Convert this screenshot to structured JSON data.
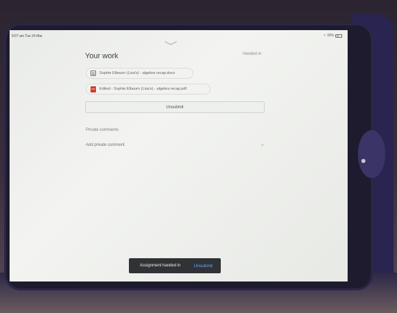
{
  "status_bar": {
    "time": "9:07 am  Tue 24 Mar",
    "battery": "33%"
  },
  "header": {
    "title": "Your work",
    "status": "Handed in"
  },
  "attachments": [
    {
      "name": "Sophie Elbourn (Lisa's) - algebra recap.docx",
      "icon": "document-icon"
    },
    {
      "name": "Edited - Sophie Elbourn (Lisa's) - algebra recap.pdf",
      "icon": "pdf-icon"
    }
  ],
  "actions": {
    "unsubmit_label": "Unsubmit"
  },
  "comments": {
    "section_label": "Private comments",
    "placeholder": "Add private comment"
  },
  "snackbar": {
    "message": "Assignment handed in",
    "action": "Unsubmit"
  }
}
